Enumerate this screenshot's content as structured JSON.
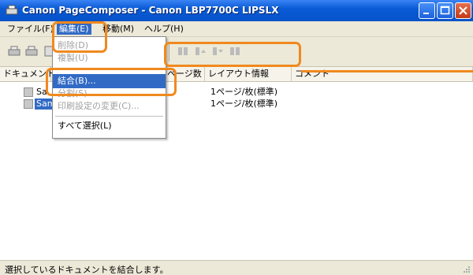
{
  "window": {
    "title": "Canon PageComposer - Canon LBP7700C LIPSLX"
  },
  "menubar": {
    "items": [
      {
        "label": "ファイル(F)"
      },
      {
        "label": "編集(E)"
      },
      {
        "label": "移動(M)"
      },
      {
        "label": "ヘルプ(H)"
      }
    ]
  },
  "list": {
    "columns": [
      "ドキュメント",
      "ページ数",
      "レイアウト情報",
      "コメント"
    ],
    "rows": [
      {
        "name": "Sa",
        "layout": "1ページ/枚(標準)"
      },
      {
        "name": "Sam",
        "layout": "1ページ/枚(標準)"
      }
    ]
  },
  "edit_menu": {
    "items": [
      {
        "label": "削除(D)",
        "enabled": false
      },
      {
        "label": "複製(U)",
        "enabled": false
      },
      {
        "label": "結合(B)...",
        "enabled": true
      },
      {
        "label": "分割(S)",
        "enabled": false
      },
      {
        "label": "印刷設定の変更(C)...",
        "enabled": false
      },
      {
        "label": "すべて選択(L)",
        "enabled": true
      }
    ]
  },
  "statusbar": {
    "text": "選択しているドキュメントを結合します。"
  },
  "colors": {
    "callout": "#f0891e",
    "selection": "#316ac5",
    "titlebar": "#0a5bd6"
  }
}
